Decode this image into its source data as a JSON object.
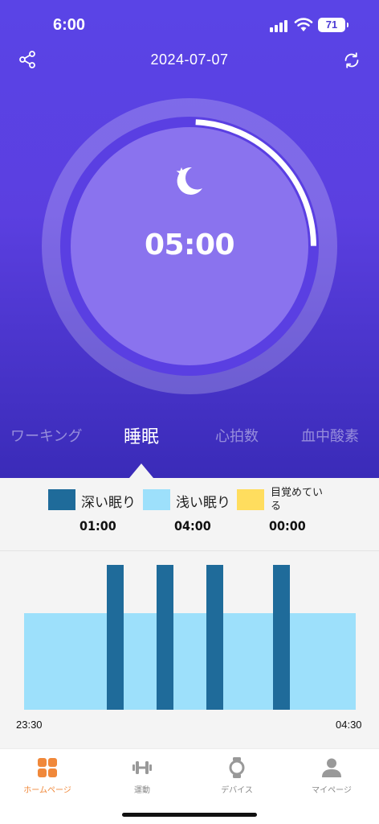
{
  "status": {
    "time": "6:00",
    "battery": "71"
  },
  "header": {
    "date": "2024-07-07"
  },
  "summary": {
    "duration": "05:00",
    "progress_fraction": 0.17
  },
  "tabs": [
    {
      "label": "ワーキング"
    },
    {
      "label": "睡眠"
    },
    {
      "label": "心拍数"
    },
    {
      "label": "血中酸素"
    }
  ],
  "legend": [
    {
      "label": "深い眠り",
      "value": "01:00",
      "color": "#1f6b9a"
    },
    {
      "label": "浅い眠り",
      "value": "04:00",
      "color": "#9de0fb"
    },
    {
      "label": "目覚めている",
      "value": "00:00",
      "color": "#ffdd5e"
    }
  ],
  "chart": {
    "start_label": "23:30",
    "end_label": "04:30"
  },
  "nav": [
    {
      "label": "ホームページ",
      "icon": "home-grid-icon"
    },
    {
      "label": "運動",
      "icon": "dumbbell-icon"
    },
    {
      "label": "デバイス",
      "icon": "watch-icon"
    },
    {
      "label": "マイページ",
      "icon": "person-icon"
    }
  ],
  "colors": {
    "accent": "#f0883a",
    "hero": "#5a44e6"
  }
}
